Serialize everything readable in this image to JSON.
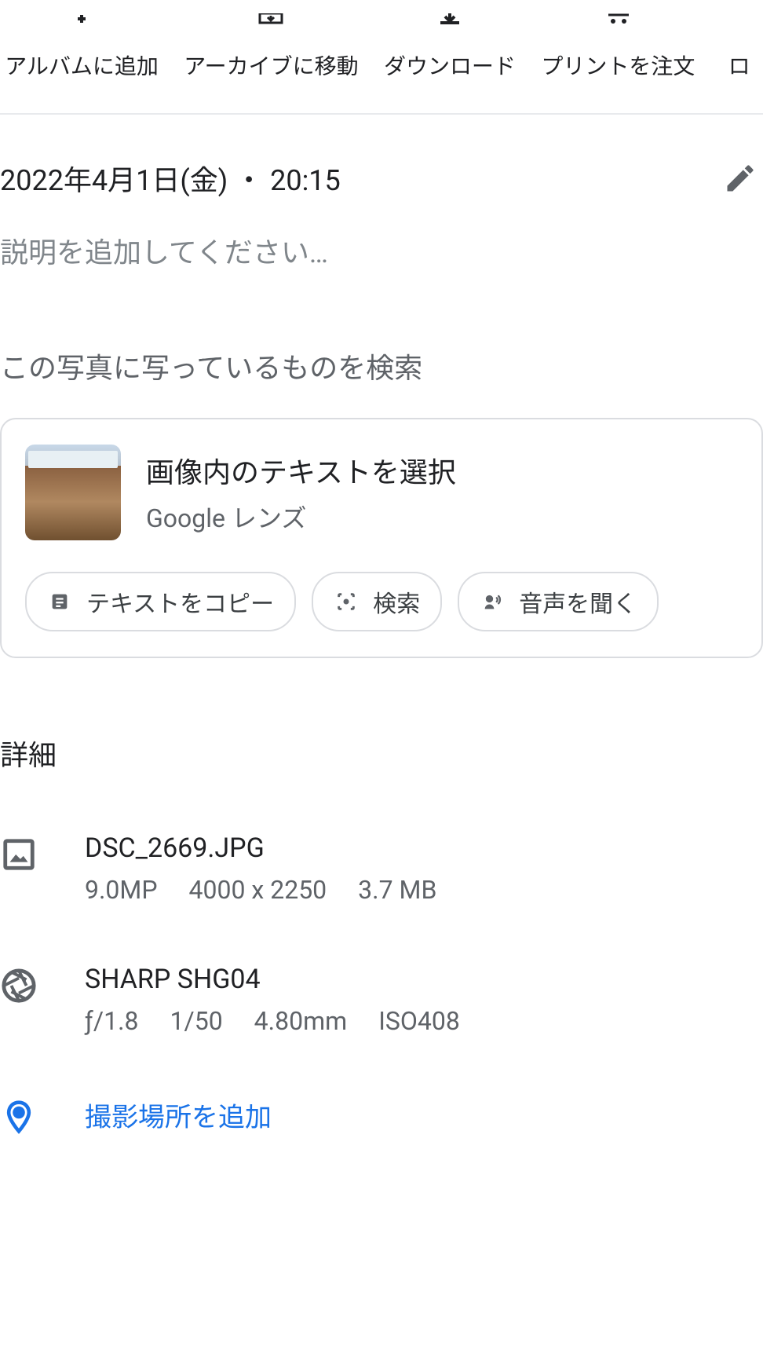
{
  "actions": {
    "album": "アルバムに追加",
    "archive": "アーカイブに移動",
    "download": "ダウンロード",
    "print": "プリントを注文",
    "lock": "ロ"
  },
  "info": {
    "datetime": "2022年4月1日(金) ・ 20:15",
    "description_placeholder": "説明を追加してください…"
  },
  "lens": {
    "title": "この写真に写っているものを検索",
    "main_text": "画像内のテキストを選択",
    "sub_text": "Google レンズ",
    "chips": {
      "copy": "テキストをコピー",
      "search": "検索",
      "listen": "音声を聞く"
    }
  },
  "details": {
    "title": "詳細",
    "file": {
      "name": "DSC_2669.JPG",
      "megapixels": "9.0MP",
      "dimensions": "4000 x 2250",
      "size": "3.7 MB"
    },
    "camera": {
      "model": "SHARP SHG04",
      "aperture_f": "ƒ/1.8",
      "shutter": "1/50",
      "focal": "4.80mm",
      "iso": "ISO408"
    },
    "location": {
      "add_text": "撮影場所を追加"
    }
  },
  "colors": {
    "link": "#1a73e8"
  }
}
